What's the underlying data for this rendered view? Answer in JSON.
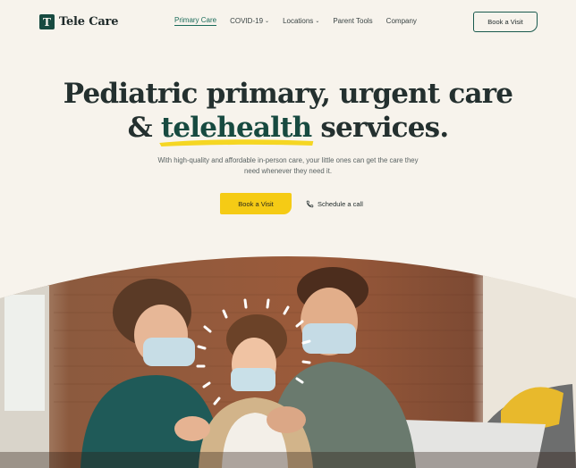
{
  "brand": {
    "name": "Tele Care",
    "mark": "T"
  },
  "nav": {
    "items": [
      {
        "label": "Primary Care",
        "active": true,
        "dropdown": false
      },
      {
        "label": "COVID-19",
        "active": false,
        "dropdown": true
      },
      {
        "label": "Locations",
        "active": false,
        "dropdown": true
      },
      {
        "label": "Parent Tools",
        "active": false,
        "dropdown": false
      },
      {
        "label": "Company",
        "active": false,
        "dropdown": false
      }
    ],
    "cta_label": "Book a Visit"
  },
  "hero": {
    "title_line1": "Pediatric primary, urgent care",
    "title_line2_prefix": "& ",
    "title_highlight": "telehealth",
    "title_line2_suffix": " services.",
    "subtitle": "With high-quality and affordable in-person care, your little ones can get the care they need whenever they need it.",
    "primary_button": "Book a Visit",
    "secondary_link": "Schedule a call",
    "secondary_icon": "phone-icon"
  },
  "colors": {
    "background": "#f7f3ec",
    "brand_green": "#174a40",
    "accent_yellow": "#f5cb15",
    "nav_active": "#1a6b5a"
  },
  "image": {
    "subject": "family-photo",
    "icon": "sparkle-rays-decoration"
  }
}
